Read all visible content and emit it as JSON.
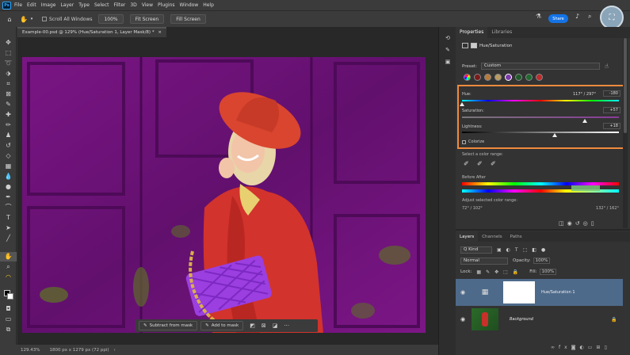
{
  "menu": {
    "items": [
      "File",
      "Edit",
      "Image",
      "Layer",
      "Type",
      "Select",
      "Filter",
      "3D",
      "View",
      "Plugins",
      "Window",
      "Help"
    ]
  },
  "options": {
    "scroll_all": "Scroll All Windows",
    "zoom": "100%",
    "fit": "Fit Screen",
    "fill": "Fill Screen",
    "share": "Share"
  },
  "document": {
    "tab": "Example-00.psd @ 129% (Hue/Saturation 1, Layer Mask/8) *",
    "tab_close": "×",
    "status_zoom": "129.43%",
    "status_size": "1800 px x 1279 px (72 ppi)"
  },
  "taskbar": {
    "subtract": "Subtract from mask",
    "add": "Add to mask",
    "more": "···"
  },
  "panel": {
    "tab_properties": "Properties",
    "tab_libraries": "Libraries",
    "header": "Hue/Saturation",
    "preset_label": "Preset:",
    "preset_value": "Custom",
    "hue_label": "Hue:",
    "hue_range": "117° / 297°",
    "hue_value": "-180",
    "sat_label": "Saturation:",
    "sat_value": "+57",
    "light_label": "Lightness:",
    "light_value": "+18",
    "colorize": "Colorize",
    "select_range": "Select a color range:",
    "before_after": "Before  After",
    "adjust_range": "Adjust selected color range:",
    "deg_left": "72° / 102°",
    "deg_right": "132° / 162°",
    "accent": "#f08a3c"
  },
  "layers": {
    "tabs": [
      "Layers",
      "Channels",
      "Paths"
    ],
    "kind": "Q Kind",
    "blend": "Normal",
    "opacity_label": "Opacity:",
    "opacity": "100%",
    "lock_label": "Lock:",
    "fill_label": "Fill:",
    "fill": "100%",
    "layer1": "Hue/Saturation 1",
    "layer2": "Background"
  }
}
